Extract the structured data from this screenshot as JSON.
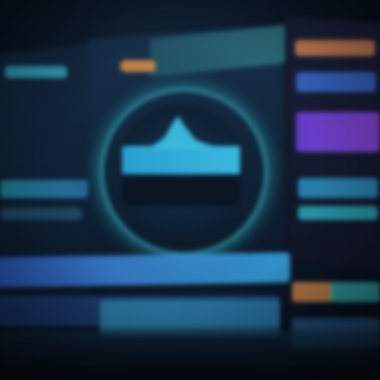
{
  "scene": {
    "description_colors": {
      "background": "#0a1626",
      "ring": "#2d8a9a",
      "accent_cyan": "#3ab8e0",
      "accent_orange": "#d08a4a",
      "accent_purple": "#8a48e0",
      "accent_blue": "#3a6fd6"
    }
  }
}
